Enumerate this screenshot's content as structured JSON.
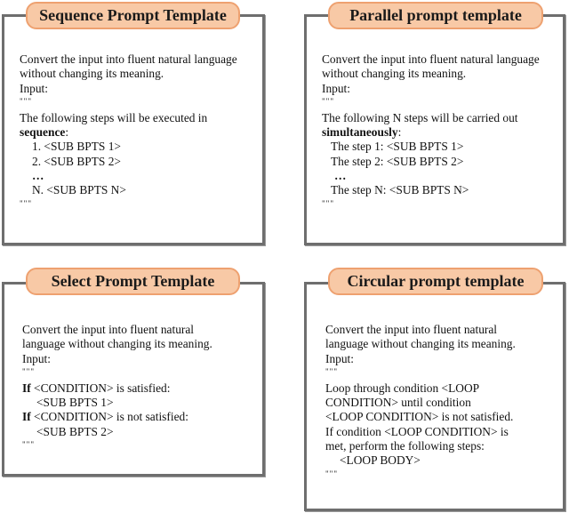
{
  "panels": {
    "sequence": {
      "title": "Sequence Prompt Template",
      "intro1": "Convert the input into fluent natural language",
      "intro2": "without changing its meaning.",
      "input_label": "Input:",
      "quote_open": "\"\"\"",
      "step_intro": "The following steps will be executed in",
      "keyword": "sequence",
      "keyword_suffix": ":",
      "steps": [
        "1. <SUB BPTS 1>",
        "2. <SUB BPTS 2>",
        "…",
        "N. <SUB BPTS N>"
      ],
      "quote_close": "\"\"\""
    },
    "parallel": {
      "title": "Parallel prompt template",
      "intro1": "Convert the input into fluent natural language",
      "intro2": "without changing its meaning.",
      "input_label": "Input:",
      "quote_open": "\"\"\"",
      "step_intro": "The following N steps will be carried out",
      "keyword": "simultaneously",
      "keyword_suffix": ":",
      "steps": [
        "The step 1: <SUB BPTS 1>",
        "The step 2: <SUB BPTS 2>",
        "…",
        "The step N: <SUB BPTS N>"
      ],
      "quote_close": "\"\"\""
    },
    "select": {
      "title": "Select Prompt Template",
      "intro1": "Convert the input into fluent natural",
      "intro2": "language without changing its meaning.",
      "input_label": "Input:",
      "quote_open": "\"\"\"",
      "if_keyword": "If",
      "cond1": " <CONDITION> is satisfied:",
      "branch1": "<SUB BPTS 1>",
      "cond2": " <CONDITION> is not satisfied:",
      "branch2": "<SUB BPTS 2>",
      "quote_close": "\"\"\""
    },
    "circular": {
      "title": "Circular prompt template",
      "intro1": "Convert the input into fluent natural",
      "intro2": "language without changing its meaning.",
      "input_label": "Input:",
      "quote_open": "\"\"\"",
      "lines": [
        "Loop through condition  <LOOP",
        "CONDITION>  until condition",
        "<LOOP CONDITION> is not satisfied.",
        "If condition <LOOP CONDITION> is",
        "met, perform the following steps:"
      ],
      "loop_body": "<LOOP BODY>",
      "quote_close": "\"\"\""
    }
  }
}
